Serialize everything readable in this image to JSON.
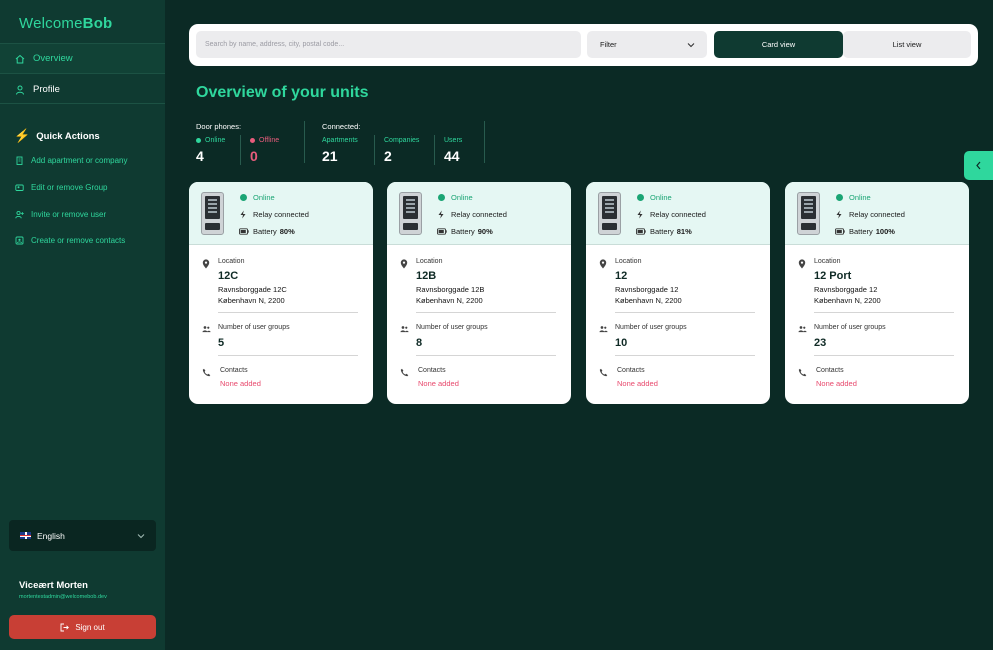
{
  "app": {
    "logo_a": "Welcome",
    "logo_b": "Bob"
  },
  "sidebar": {
    "nav": [
      {
        "label": "Overview",
        "icon": "home-icon"
      },
      {
        "label": "Profile",
        "icon": "person-icon"
      }
    ],
    "quick_actions_title": "Quick Actions",
    "quick_actions": [
      {
        "label": "Add apartment or company",
        "icon": "building-icon"
      },
      {
        "label": "Edit or remove Group",
        "icon": "group-icon"
      },
      {
        "label": "Invite or remove user",
        "icon": "user-plus-icon"
      },
      {
        "label": "Create or remove contacts",
        "icon": "contacts-icon"
      }
    ],
    "language": "English",
    "user_name": "Viceært Morten",
    "user_email": "mortentestadmin@welcomebob.dev",
    "signout_label": "Sign out"
  },
  "toolbar": {
    "search_placeholder": "Search by name, address, city, postal code...",
    "filter_label": "Filter",
    "card_view_label": "Card view",
    "list_view_label": "List view"
  },
  "page_title": "Overview of your units",
  "stats": {
    "door_phones_label": "Door phones:",
    "online_label": "Online",
    "online_value": "4",
    "offline_label": "Offline",
    "offline_value": "0",
    "connected_label": "Connected:",
    "apartments_label": "Apartments",
    "apartments_value": "21",
    "companies_label": "Companies",
    "companies_value": "2",
    "users_label": "Users",
    "users_value": "44"
  },
  "card_labels": {
    "online": "Online",
    "relay": "Relay connected",
    "battery": "Battery",
    "location": "Location",
    "groups": "Number of user groups",
    "contacts": "Contacts",
    "none_added": "None added"
  },
  "cards": [
    {
      "battery": "80%",
      "name": "12C",
      "street": "Ravnsborggade 12C",
      "city": "København N, 2200",
      "groups": "5"
    },
    {
      "battery": "90%",
      "name": "12B",
      "street": "Ravnsborggade 12B",
      "city": "København N, 2200",
      "groups": "8"
    },
    {
      "battery": "81%",
      "name": "12",
      "street": "Ravnsborggade 12",
      "city": "København N, 2200",
      "groups": "10"
    },
    {
      "battery": "100%",
      "name": "12 Port",
      "street": "Ravnsborggade 12",
      "city": "København N, 2200",
      "groups": "23"
    }
  ],
  "colors": {
    "accent": "#2fd79d",
    "dark": "#0b2a25",
    "sidebar": "#0f3a31",
    "offline": "#e85c7c",
    "signout": "#c83f35"
  }
}
